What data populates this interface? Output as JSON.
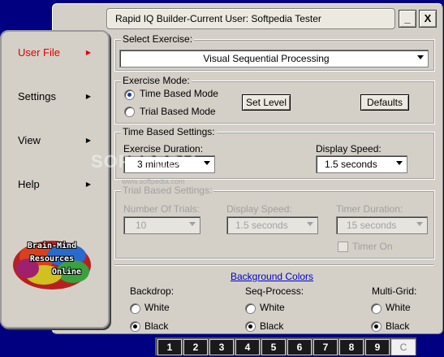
{
  "window": {
    "title": "Rapid IQ Builder-Current User: Softpedia Tester",
    "minimize_label": "_",
    "close_label": "X"
  },
  "sidebar": {
    "items": [
      {
        "label": "User File",
        "active": true
      },
      {
        "label": "Settings"
      },
      {
        "label": "View"
      },
      {
        "label": "Help"
      }
    ],
    "arrow_glyph": "▶",
    "logo": {
      "line1": "Brain-Mind",
      "line2": "Resources",
      "line3": "Online"
    }
  },
  "select_exercise": {
    "label": "Select Exercise:",
    "value": "Visual Sequential Processing"
  },
  "exercise_mode": {
    "label": "Exercise Mode:",
    "time_based": "Time Based Mode",
    "trial_based": "Trial Based Mode",
    "selected": "time_based",
    "set_level": "Set Level",
    "defaults": "Defaults"
  },
  "time_based_settings": {
    "label": "Time Based Settings:",
    "duration_label": "Exercise Duration:",
    "duration_value": "3 minutes",
    "speed_label": "Display Speed:",
    "speed_value": "1.5 seconds"
  },
  "trial_based_settings": {
    "label": "Trial Based Settings:",
    "trials_label": "Number Of Trials:",
    "trials_value": "10",
    "speed_label": "Display Speed:",
    "speed_value": "1.5 seconds",
    "timer_label": "Timer Duration:",
    "timer_value": "15 seconds",
    "timer_on_label": "Timer On"
  },
  "background_colors": {
    "link": "Background Colors",
    "backdrop": {
      "label": "Backdrop:",
      "white": "White",
      "black": "Black",
      "selected": "black"
    },
    "seq_process": {
      "label": "Seq-Process:",
      "white": "White",
      "black": "Black",
      "selected": "black"
    },
    "multi_grid": {
      "label": "Multi-Grid:",
      "white": "White",
      "black": "Black",
      "selected": "black"
    }
  },
  "watermark": {
    "text": "SOFTPEDIA",
    "url": "www.softpedia.com"
  },
  "grid_bar": {
    "cells": [
      "1",
      "2",
      "3",
      "4",
      "5",
      "6",
      "7",
      "8",
      "9"
    ],
    "clear": "C"
  },
  "colors": {
    "desktop": "#000080",
    "panel": "#d4d0c8",
    "active_menu": "#e00000",
    "link": "#0000cc"
  }
}
